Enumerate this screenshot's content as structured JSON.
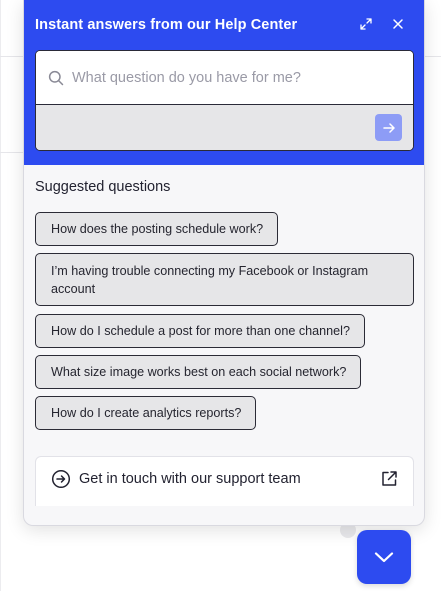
{
  "header": {
    "title": "Instant answers from our Help Center",
    "expand_icon": "expand-icon",
    "close_icon": "close-icon"
  },
  "search": {
    "placeholder": "What question do you have for me?",
    "value": "",
    "search_icon": "search-icon",
    "send_icon": "arrow-right-icon"
  },
  "suggestions": {
    "title": "Suggested questions",
    "items": [
      "How does the posting schedule work?",
      "I’m having trouble connecting my Facebook or Instagram account",
      "How do I schedule a post for more than one channel?",
      "What size image works best on each social network?",
      "How do I create analytics reports?"
    ]
  },
  "support": {
    "label": "Get in touch with our support team",
    "icon": "arrow-circle-right-icon",
    "external_icon": "external-link-icon"
  },
  "launcher": {
    "icon": "chevron-down-icon"
  },
  "colors": {
    "brand": "#2d4bf0",
    "send_button_disabled": "#8d9cf6",
    "panel_background": "#f7f7f9",
    "chip_background": "#e6e6e8"
  }
}
